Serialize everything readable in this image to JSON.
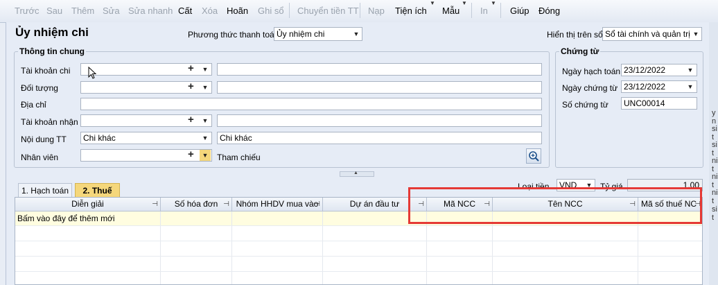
{
  "toolbar": {
    "items": [
      {
        "label": "Trước",
        "enabled": false
      },
      {
        "label": "Sau",
        "enabled": false
      },
      {
        "label": "Thêm",
        "enabled": false
      },
      {
        "label": "Sửa",
        "enabled": false
      },
      {
        "label": "Sửa nhanh",
        "enabled": false
      },
      {
        "label": "Cất",
        "enabled": true
      },
      {
        "label": "Xóa",
        "enabled": false
      },
      {
        "label": "Hoãn",
        "enabled": true
      },
      {
        "label": "Ghi sổ",
        "enabled": false
      },
      {
        "label": "Chuyển tiền TT",
        "enabled": false
      },
      {
        "label": "Nạp",
        "enabled": false
      },
      {
        "label": "Tiện ích",
        "enabled": true
      },
      {
        "label": "Mẫu",
        "enabled": true
      },
      {
        "label": "In",
        "enabled": false
      },
      {
        "label": "Giúp",
        "enabled": true
      },
      {
        "label": "Đóng",
        "enabled": true
      }
    ]
  },
  "form": {
    "title": "Ủy nhiệm chi",
    "payment_method_label": "Phương thức thanh toán",
    "payment_method_value": "Ủy nhiệm chi",
    "display_book_label": "Hiển thị trên sổ",
    "display_book_value": "Sổ tài chính và quản trị"
  },
  "general": {
    "legend": "Thông tin chung",
    "account_label": "Tài khoản chi",
    "account_value": "",
    "account_desc": "",
    "object_label": "Đối tượng",
    "object_value": "",
    "object_desc": "",
    "address_label": "Địa chỉ",
    "address_value": "",
    "receive_account_label": "Tài khoản nhận",
    "receive_account_value": "",
    "receive_account_desc": "",
    "content_label": "Nội dung TT",
    "content_value": "Chi khác",
    "content_desc": "Chi khác",
    "employee_label": "Nhân viên",
    "employee_value": "",
    "reference_label": "Tham chiếu"
  },
  "voucher": {
    "legend": "Chứng từ",
    "posting_date_label": "Ngày hạch toán",
    "posting_date_value": "23/12/2022",
    "voucher_date_label": "Ngày chứng từ",
    "voucher_date_value": "23/12/2022",
    "voucher_no_label": "Số chứng từ",
    "voucher_no_value": "UNC00014"
  },
  "currency": {
    "label": "Loại tiền",
    "value": "VND",
    "rate_label": "Tỷ giá",
    "rate_value": "1,00"
  },
  "tabs": [
    {
      "label": "1. Hạch toán",
      "active": false
    },
    {
      "label": "2. Thuế",
      "active": true
    }
  ],
  "grid": {
    "columns": [
      "Diễn giải",
      "Số hóa đơn",
      "Nhóm HHDV mua vào",
      "Dự án đầu tư",
      "Mã NCC",
      "Tên NCC",
      "Mã số thuế NC"
    ],
    "rows": [
      [
        "Bấm vào đây để thêm mới",
        "",
        "",
        "",
        "",
        "",
        ""
      ]
    ]
  },
  "right_strip": [
    "y n",
    "si t",
    "si t",
    "ni t",
    "ni t",
    "ni t",
    "si t"
  ],
  "colors": {
    "highlight_border": "#e53935",
    "new_row_bg": "#fffde0",
    "active_tab": "#f5d77b"
  }
}
